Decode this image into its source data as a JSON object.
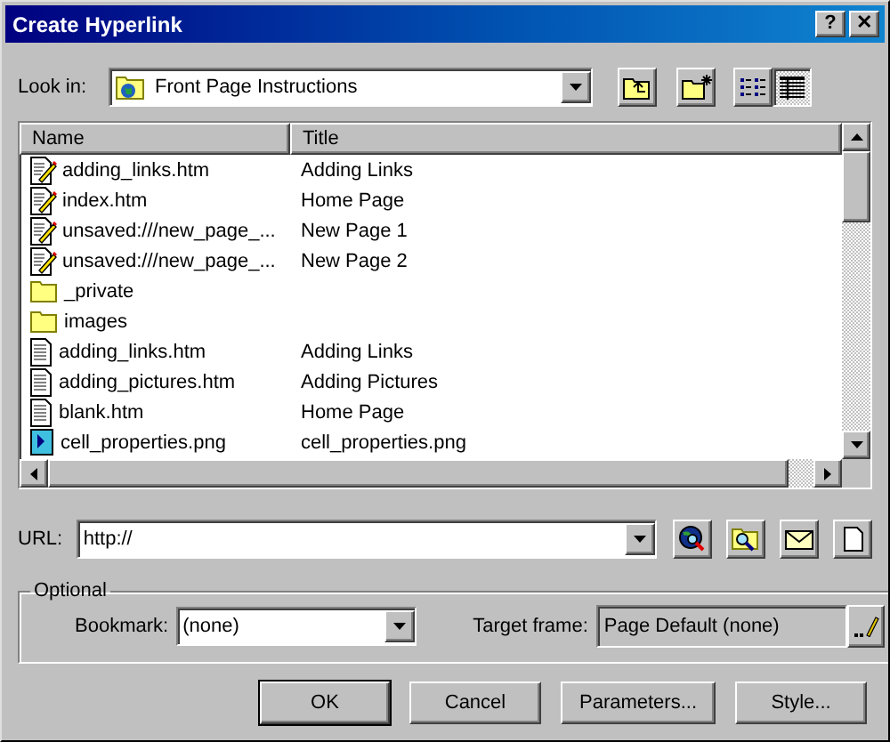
{
  "window": {
    "title": "Create Hyperlink",
    "title_buttons": [
      "?",
      "✕"
    ]
  },
  "look_in": {
    "label": "Look in:",
    "value": "Front Page Instructions",
    "view_buttons": [
      {
        "kind": "list",
        "selected": false
      },
      {
        "kind": "details",
        "selected": true
      }
    ]
  },
  "file_list": {
    "columns": [
      "Name",
      "Title"
    ],
    "rows": [
      {
        "kind": "page-edit",
        "name": "adding_links.htm",
        "title": "Adding Links"
      },
      {
        "kind": "page-edit",
        "name": "index.htm",
        "title": "Home Page"
      },
      {
        "kind": "page-edit",
        "name": "unsaved:///new_page_...",
        "title": "New Page 1"
      },
      {
        "kind": "page-edit",
        "name": "unsaved:///new_page_...",
        "title": "New Page 2"
      },
      {
        "kind": "folder",
        "name": "_private",
        "title": ""
      },
      {
        "kind": "folder",
        "name": "images",
        "title": ""
      },
      {
        "kind": "page",
        "name": "adding_links.htm",
        "title": "Adding Links"
      },
      {
        "kind": "page",
        "name": "adding_pictures.htm",
        "title": "Adding Pictures"
      },
      {
        "kind": "page",
        "name": "blank.htm",
        "title": "Home Page"
      },
      {
        "kind": "image",
        "name": "cell_properties.png",
        "title": "cell_properties.png"
      }
    ]
  },
  "url": {
    "label": "URL:",
    "value": "http://"
  },
  "optional": {
    "legend": "Optional",
    "bookmark_label": "Bookmark:",
    "bookmark_value": "(none)",
    "target_label": "Target frame:",
    "target_value": "Page Default (none)"
  },
  "buttons": [
    "OK",
    "Cancel",
    "Parameters...",
    "Style..."
  ]
}
